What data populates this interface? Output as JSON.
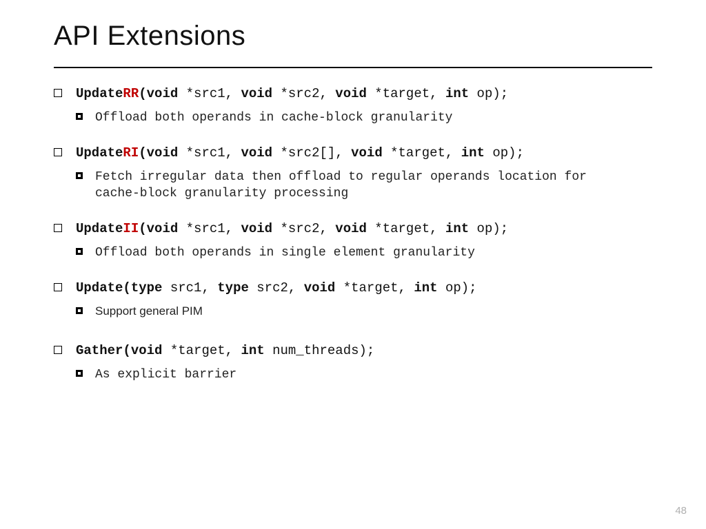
{
  "title": "API Extensions",
  "page_number": "48",
  "items": [
    {
      "fn_prefix": "Update",
      "fn_suffix": "RR",
      "o": "(",
      "p0_kw": "void",
      "p0_tx": " *src1, ",
      "p1_kw": "void",
      "p1_tx": " *src2, ",
      "p2_kw": "void",
      "p2_tx": " *target, ",
      "p3_kw": "int",
      "p3_tx": " op);",
      "desc": "Offload both operands in cache-block granularity",
      "desc_mono": true
    },
    {
      "fn_prefix": "Update",
      "fn_suffix": "RI",
      "o": "(",
      "p0_kw": "void",
      "p0_tx": " *src1, ",
      "p1_kw": "void",
      "p1_tx": " *src2[], ",
      "p2_kw": "void",
      "p2_tx": " *target, ",
      "p3_kw": "int",
      "p3_tx": " op);",
      "desc": "Fetch irregular data then offload to regular operands location for cache-block granularity processing",
      "desc_mono": true
    },
    {
      "fn_prefix": "Update",
      "fn_suffix": "II",
      "o": "(",
      "p0_kw": "void",
      "p0_tx": " *src1, ",
      "p1_kw": "void",
      "p1_tx": " *src2, ",
      "p2_kw": "void",
      "p2_tx": " *target, ",
      "p3_kw": "int",
      "p3_tx": " op);",
      "desc": "Offload both operands in single element granularity",
      "desc_mono": true
    },
    {
      "fn_prefix": "Update",
      "fn_suffix": "",
      "o": "(",
      "p0_kw": "type",
      "p0_tx": " src1, ",
      "p1_kw": "type",
      "p1_tx": " src2, ",
      "p2_kw": "void",
      "p2_tx": " *target, ",
      "p3_kw": "int",
      "p3_tx": " op);",
      "desc": "Support general PIM",
      "desc_mono": false
    },
    {
      "fn_prefix": "Gather",
      "fn_suffix": "",
      "o": "(",
      "p0_kw": "void",
      "p0_tx": " *target, ",
      "p1_kw": "int",
      "p1_tx": " num_threads);",
      "p2_kw": "",
      "p2_tx": "",
      "p3_kw": "",
      "p3_tx": "",
      "desc": "As explicit barrier",
      "desc_mono": true
    }
  ]
}
